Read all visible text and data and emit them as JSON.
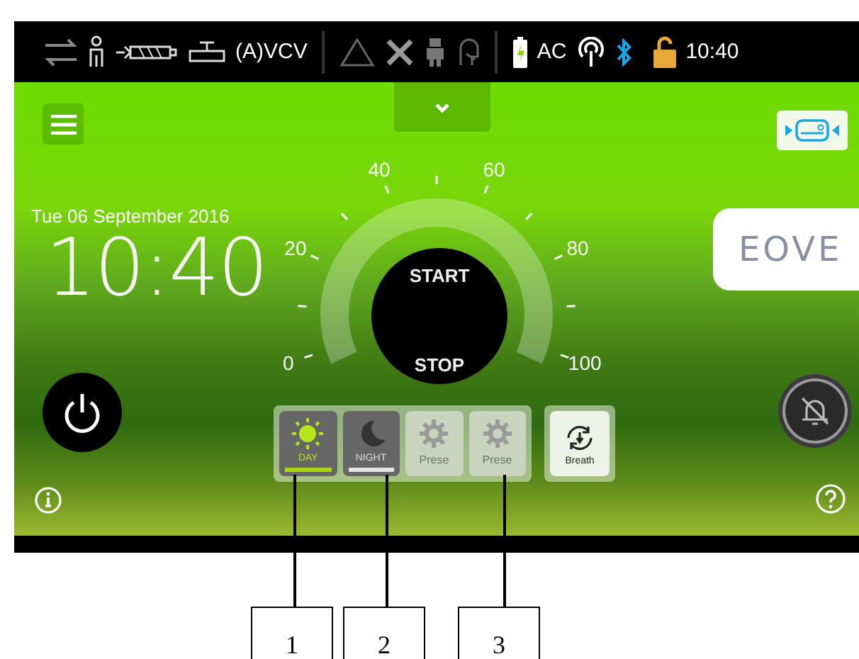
{
  "status_bar": {
    "mode": "(A)VCV",
    "power": "AC",
    "time": "10:40"
  },
  "clock": {
    "date": "Tue 06 September 2016",
    "time": "10:40"
  },
  "dial": {
    "scale": [
      "0",
      "20",
      "40",
      "60",
      "80",
      "100"
    ],
    "start_label": "START",
    "stop_label": "STOP"
  },
  "logo": {
    "text": "EOVE"
  },
  "modes": [
    {
      "kind": "day",
      "label": "DAY",
      "selected": true,
      "disabled": false
    },
    {
      "kind": "night",
      "label": "NIGHT",
      "selected": false,
      "disabled": false
    },
    {
      "kind": "preset",
      "label": "Prese",
      "selected": false,
      "disabled": true
    },
    {
      "kind": "preset",
      "label": "Prese",
      "selected": false,
      "disabled": true
    }
  ],
  "breath_button": {
    "label": "Breath"
  },
  "callouts": [
    "1",
    "2",
    "3"
  ]
}
